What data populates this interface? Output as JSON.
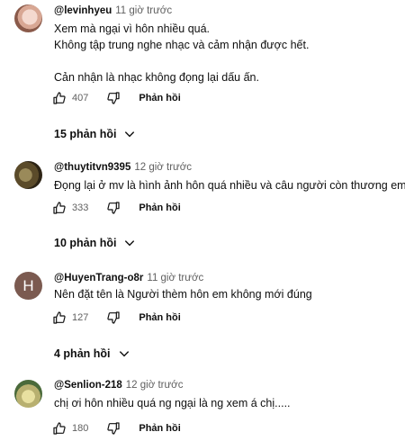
{
  "comments": [
    {
      "author": "@levinhyeu",
      "time": "11 giờ trước",
      "lines": [
        "Xem mà ngại vì hôn nhiều quá.",
        "Không tập trung nghe nhạc và cảm nhận được hết."
      ],
      "lines2": [
        "Cản nhận là nhạc không đọng lại dấu ấn."
      ],
      "likes": "407",
      "reply_label": "Phản hồi",
      "replies": "15 phản hồi"
    },
    {
      "author": "@thuytitvn9395",
      "time": "12 giờ trước",
      "lines": [
        "Đọng lại ở mv là hình ảnh hôn quá nhiều và câu người còn thương em k !"
      ],
      "likes": "333",
      "reply_label": "Phản hồi",
      "replies": "10 phản hồi"
    },
    {
      "author": "@HuyenTrang-o8r",
      "time": "11 giờ trước",
      "avatar_letter": "H",
      "lines": [
        "Nên đặt tên là Người thèm hôn em không mới đúng"
      ],
      "likes": "127",
      "reply_label": "Phản hồi",
      "replies": "4 phản hồi"
    },
    {
      "author": "@Senlion-218",
      "time": "12 giờ trước",
      "lines": [
        "chị ơi hôn nhiều quá ng ngại là ng xem á chị....."
      ],
      "likes": "180",
      "reply_label": "Phản hồi"
    }
  ]
}
